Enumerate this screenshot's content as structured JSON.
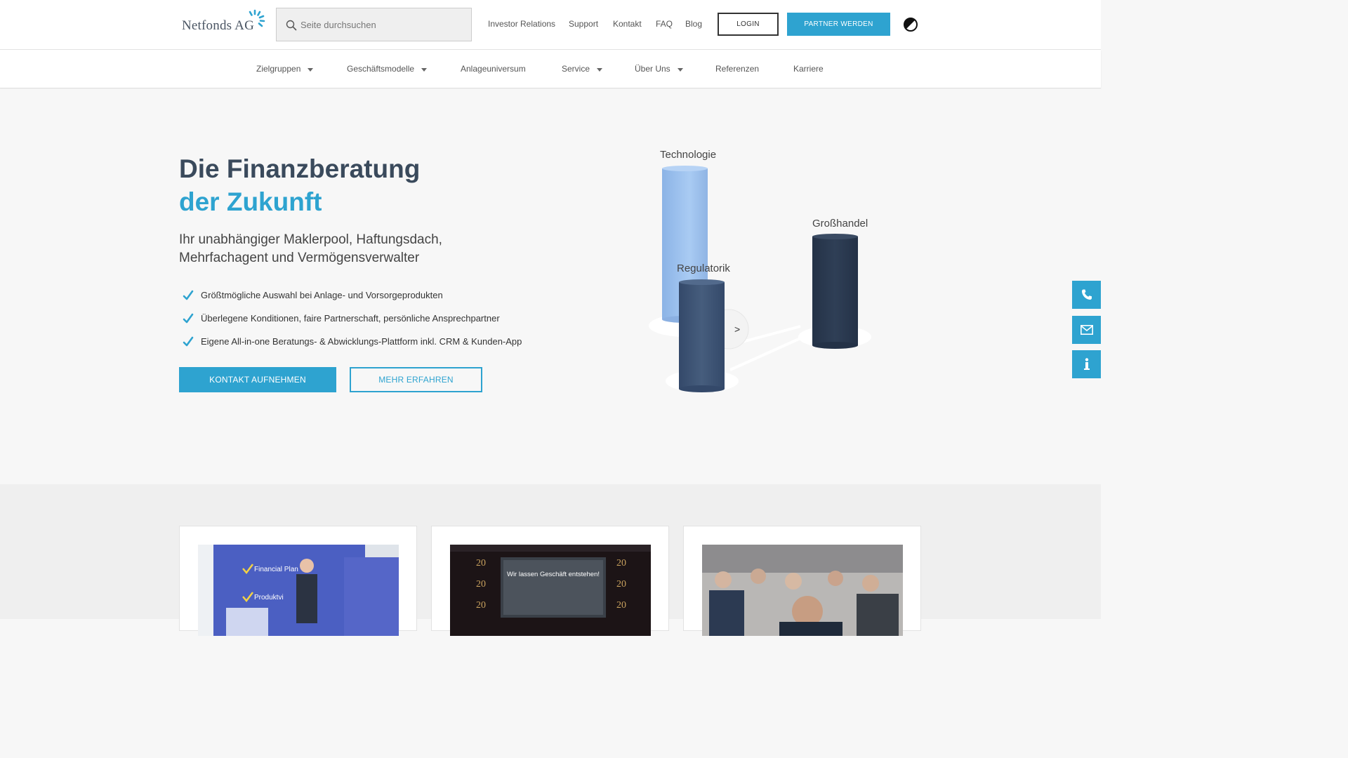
{
  "header": {
    "logo_text": "Netfonds AG",
    "search_placeholder": "Seite durchsuchen",
    "links": [
      "Investor Relations",
      "Support",
      "Kontakt",
      "FAQ",
      "Blog"
    ],
    "login_label": "LOGIN",
    "partner_label": "PARTNER WERDEN"
  },
  "nav": {
    "items": [
      {
        "label": "Zielgruppen",
        "dropdown": true
      },
      {
        "label": "Geschäftsmodelle",
        "dropdown": true
      },
      {
        "label": "Anlageuniversum",
        "dropdown": false
      },
      {
        "label": "Service",
        "dropdown": true
      },
      {
        "label": "Über Uns",
        "dropdown": true
      },
      {
        "label": "Referenzen",
        "dropdown": false
      },
      {
        "label": "Karriere",
        "dropdown": false
      }
    ]
  },
  "hero": {
    "title_line1": "Die Finanzberatung",
    "title_line2": "der Zukunft",
    "subtitle_line1": "Ihr unabhängiger Maklerpool, Haftungsdach,",
    "subtitle_line2": "Mehrfachagent und Vermögensverwalter",
    "bullets": [
      "Größtmögliche Auswahl bei Anlage- und Vorsorgeprodukten",
      "Überlegene Konditionen, faire Partnerschaft, persönliche Ansprechpartner",
      "Eigene All-in-one Beratungs- & Abwicklungs-Plattform inkl. CRM & Kunden-App"
    ],
    "primary_cta": "KONTAKT AUFNEHMEN",
    "secondary_cta": "MEHR ERFAHREN",
    "pillars": {
      "technologie": "Technologie",
      "regulatorik": "Regulatorik",
      "grosshandel": "Großhandel"
    }
  },
  "cards": [
    {
      "image": "Financial Planning Event-Foto"
    },
    {
      "image": "Wir lassen Geschäft entstehen!"
    },
    {
      "image": "Publikum-Foto"
    }
  ],
  "card_images": {
    "card1_line1": "Financial Plan",
    "card1_line2": "Produktvi",
    "card2_headline": "Wir lassen Geschäft entstehen!"
  },
  "colors": {
    "accent": "#2ea3d0",
    "navy": "#3a4a5c",
    "pillar_light": "#9fc3ef",
    "pillar_mid": "#3f5573",
    "pillar_dark": "#2b3a4e"
  },
  "side_actions": [
    "phone-icon",
    "mail-icon",
    "info-icon"
  ]
}
